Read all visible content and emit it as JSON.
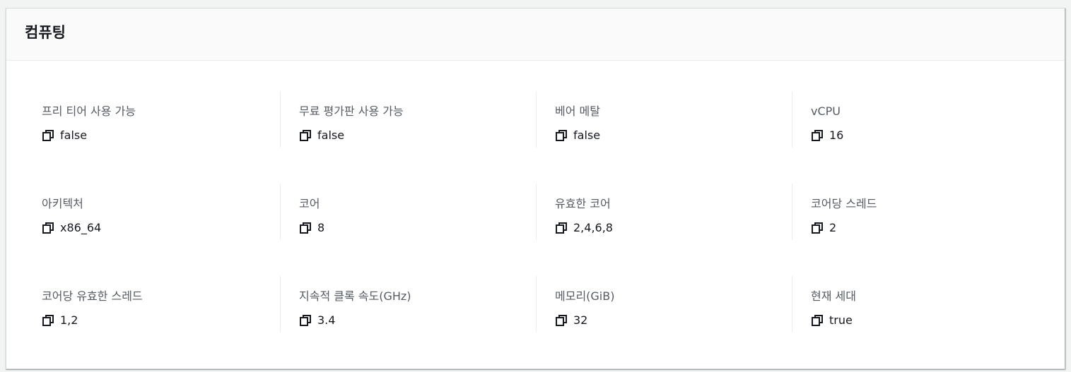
{
  "panel": {
    "title": "컴퓨팅"
  },
  "colors": {
    "label": "#545b64",
    "value": "#16191f",
    "divider": "#eaeded",
    "header_bg": "#fafafa"
  },
  "items": [
    {
      "label": "프리 티어 사용 가능",
      "value": "false",
      "icon": "copy-icon"
    },
    {
      "label": "무료 평가판 사용 가능",
      "value": "false",
      "icon": "copy-icon"
    },
    {
      "label": "베어 메탈",
      "value": "false",
      "icon": "copy-icon"
    },
    {
      "label": "vCPU",
      "value": "16",
      "icon": "copy-icon"
    },
    {
      "label": "아키텍처",
      "value": "x86_64",
      "icon": "copy-icon"
    },
    {
      "label": "코어",
      "value": "8",
      "icon": "copy-icon"
    },
    {
      "label": "유효한 코어",
      "value": "2,4,6,8",
      "icon": "copy-icon"
    },
    {
      "label": "코어당 스레드",
      "value": "2",
      "icon": "copy-icon"
    },
    {
      "label": "코어당 유효한 스레드",
      "value": "1,2",
      "icon": "copy-icon"
    },
    {
      "label": "지속적 클록 속도(GHz)",
      "value": "3.4",
      "icon": "copy-icon"
    },
    {
      "label": "메모리(GiB)",
      "value": "32",
      "icon": "copy-icon"
    },
    {
      "label": "현재 세대",
      "value": "true",
      "icon": "copy-icon"
    }
  ]
}
